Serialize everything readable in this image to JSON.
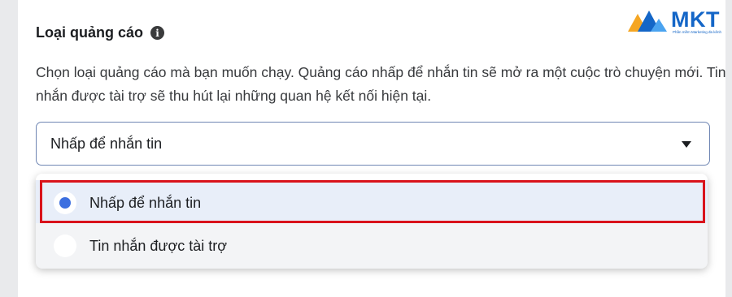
{
  "ad_type": {
    "title": "Loại quảng cáo",
    "description": "Chọn loại quảng cáo mà bạn muốn chạy. Quảng cáo nhấp để nhắn tin sẽ mở ra một cuộc trò chuyện mới. Tin nhắn được tài trợ sẽ thu hút lại những quan hệ kết nối hiện tại.",
    "selected_value": "Nhấp để nhắn tin",
    "options": [
      {
        "label": "Nhấp để nhắn tin",
        "selected": true
      },
      {
        "label": "Tin nhắn được tài trợ",
        "selected": false
      }
    ]
  },
  "logo": {
    "brand": "MKT",
    "tagline": "Phần mềm Marketing đa kênh"
  },
  "icons": {
    "info": "info-icon",
    "dropdown": "caret-down-icon",
    "radio": "radio-icon"
  },
  "colors": {
    "highlight": "#d9131b",
    "radio_selected": "#3c6fe0",
    "selected_row_bg": "#e8eef9",
    "brand": "#1466c7",
    "brand_secondary": "#f5a623"
  }
}
